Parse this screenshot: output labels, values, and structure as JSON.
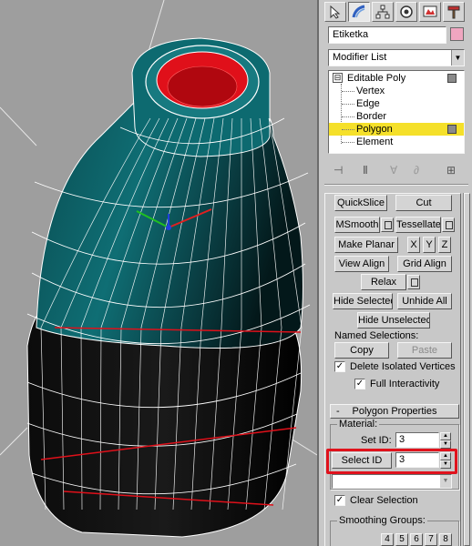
{
  "viewport": {
    "background": "#9e9e9e",
    "bottle_color": "#0f6e74",
    "rim_color": "#e0101a",
    "wire_color": "#ffffff"
  },
  "tabs": [
    {
      "icon": "create-arrow-icon"
    },
    {
      "icon": "modify-bend-icon"
    },
    {
      "icon": "hierarchy-icon"
    },
    {
      "icon": "motion-icon"
    },
    {
      "icon": "display-icon"
    },
    {
      "icon": "utilities-hammer-icon"
    }
  ],
  "object": {
    "name": "Etiketka",
    "color": "#f0a6c0"
  },
  "modifier_list": {
    "label": "Modifier List",
    "arrow": "▼"
  },
  "stack": {
    "root": "Editable Poly",
    "root_toggle": "⊟",
    "items": [
      "Vertex",
      "Edge",
      "Border",
      "Polygon",
      "Element"
    ],
    "selected": "Polygon"
  },
  "stack_tools": {
    "pin": "⊣",
    "show_end": "Ⅱ",
    "make_unique": "∀",
    "remove": "∂",
    "configure": "⊞"
  },
  "edit_geometry": {
    "quickslice": "QuickSlice",
    "cut": "Cut",
    "msmooth": "MSmooth",
    "tessellate": "Tessellate",
    "make_planar": "Make Planar",
    "x": "X",
    "y": "Y",
    "z": "Z",
    "view_align": "View Align",
    "grid_align": "Grid Align",
    "relax": "Relax",
    "hide_selected": "Hide Selected",
    "unhide_all": "Unhide All",
    "hide_unselected": "Hide Unselected",
    "named_selections": "Named Selections:",
    "copy": "Copy",
    "paste": "Paste",
    "delete_isolated": "Delete Isolated Vertices",
    "full_interactivity": "Full Interactivity",
    "check_mark": "✓"
  },
  "polygon_properties": {
    "collapse": "-",
    "title": "Polygon Properties",
    "material_label": "Material:",
    "set_id_label": "Set ID:",
    "set_id_value": "3",
    "select_id_button": "Select ID",
    "select_id_value": "3",
    "clear_selection": "Clear Selection",
    "smoothing_groups": "Smoothing Groups:",
    "sg_buttons": [
      "4",
      "5",
      "6",
      "7",
      "8"
    ]
  },
  "annotation": {
    "highlight_color": "#e0121c"
  }
}
